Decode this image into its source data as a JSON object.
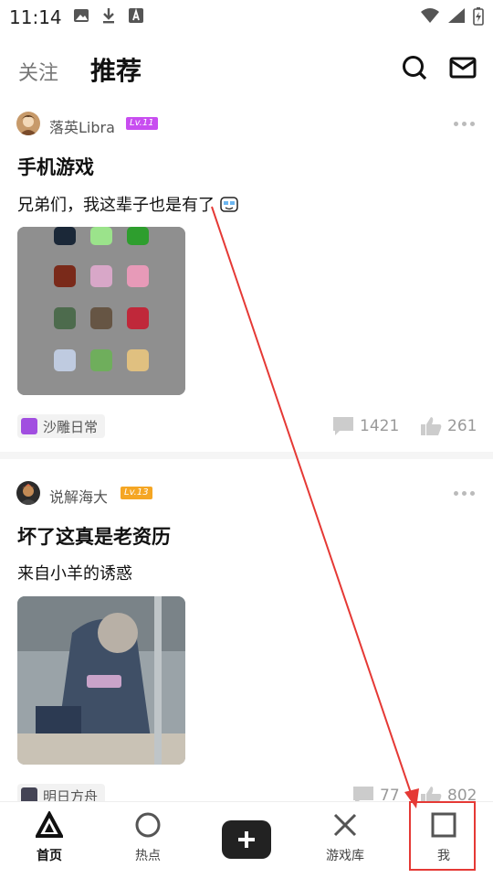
{
  "status": {
    "time": "11:14"
  },
  "header": {
    "tab_follow": "关注",
    "tab_recommend": "推荐"
  },
  "posts": [
    {
      "username": "落英Libra",
      "level": "Lv.11",
      "level_color": "#c84df0",
      "title": "手机游戏",
      "text": "兄弟们，我这辈子也是有了",
      "topic": "沙雕日常",
      "comments": "1421",
      "likes": "261"
    },
    {
      "username": "说解海大",
      "level": "Lv.13",
      "level_color": "#f5a623",
      "title": "坏了这真是老资历",
      "text": "来自小羊的诱惑",
      "topic": "明日方舟",
      "comments": "77",
      "likes": "802"
    }
  ],
  "bottom_nav": {
    "home": "首页",
    "hot": "热点",
    "library": "游戏库",
    "me": "我"
  },
  "colors": {
    "accent_red": "#e53935"
  }
}
